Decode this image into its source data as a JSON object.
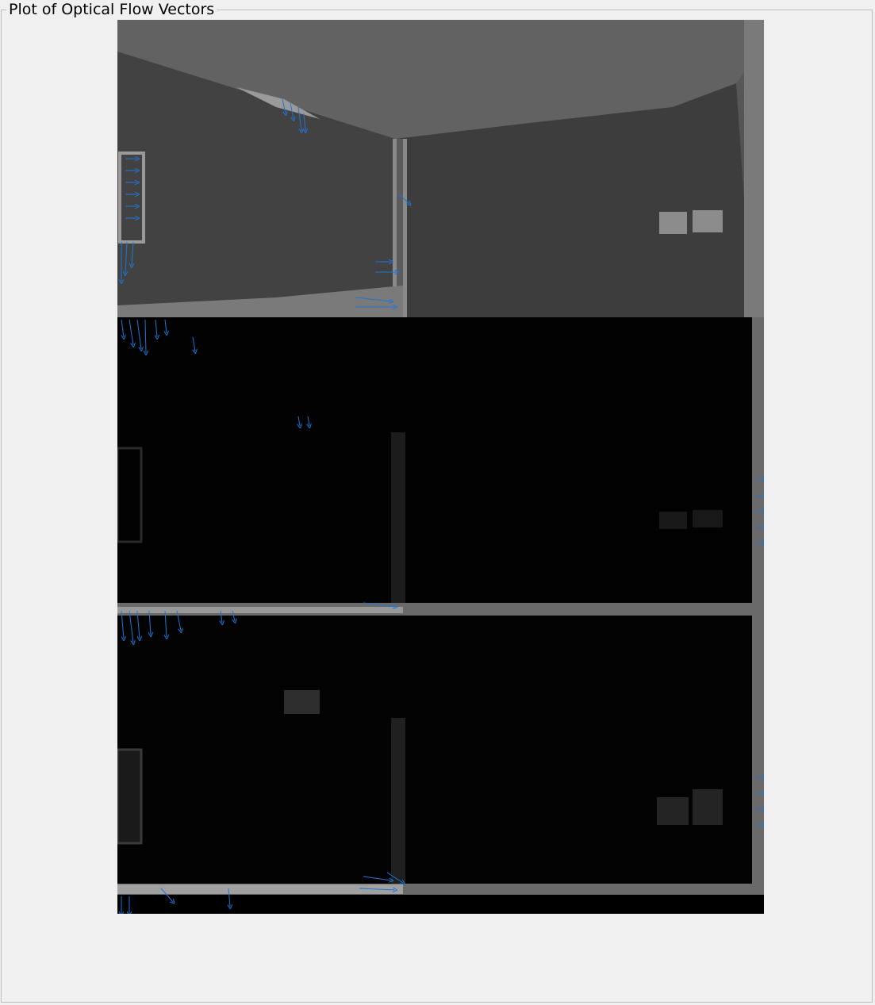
{
  "panel": {
    "title": "Plot of Optical Flow Vectors"
  },
  "plot": {
    "image_description_icon": "grayscale-camera-frames-icon",
    "vector_color": "#1f77d4",
    "frame_count": 3
  }
}
